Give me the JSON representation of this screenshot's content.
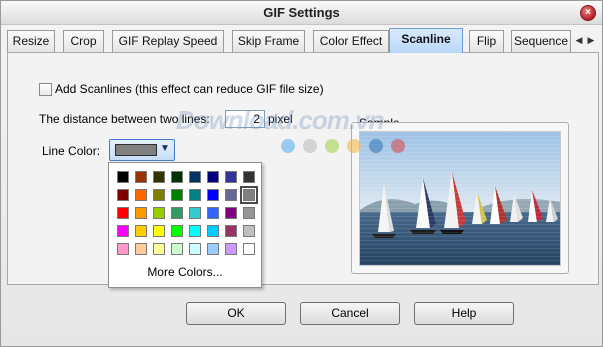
{
  "window": {
    "title": "GIF Settings"
  },
  "tabs": [
    {
      "label": "Resize"
    },
    {
      "label": "Crop"
    },
    {
      "label": "GIF Replay Speed"
    },
    {
      "label": "Skip Frame"
    },
    {
      "label": "Color Effect"
    },
    {
      "label": "Scanline",
      "active": true
    },
    {
      "label": "Flip"
    },
    {
      "label": "Sequence"
    }
  ],
  "tab_scroll": {
    "left": "◀",
    "right": "▶"
  },
  "scanline": {
    "add_checkbox_label": "Add Scanlines (this effect can reduce GIF file size)",
    "add_checked": false,
    "distance_label": "The distance between two lines:",
    "distance_value": "2",
    "distance_unit": "pixel",
    "line_color_label": "Line Color:",
    "line_color_value": "#808080",
    "sample_label": "Sample"
  },
  "color_picker": {
    "colors": [
      [
        "#000000",
        "#993300",
        "#333300",
        "#003300",
        "#003366",
        "#000080",
        "#333399",
        "#333333"
      ],
      [
        "#800000",
        "#ff6600",
        "#808000",
        "#008000",
        "#008080",
        "#0000ff",
        "#666699",
        "#808080"
      ],
      [
        "#ff0000",
        "#ff9900",
        "#99cc00",
        "#339966",
        "#33cccc",
        "#3366ff",
        "#800080",
        "#969696"
      ],
      [
        "#ff00ff",
        "#ffcc00",
        "#ffff00",
        "#00ff00",
        "#00ffff",
        "#00ccff",
        "#993366",
        "#c0c0c0"
      ],
      [
        "#ff99cc",
        "#ffcc99",
        "#ffff99",
        "#ccffcc",
        "#ccffff",
        "#99ccff",
        "#cc99ff",
        "#ffffff"
      ]
    ],
    "selected": "#808080",
    "more_colors_label": "More Colors..."
  },
  "buttons": {
    "ok": "OK",
    "cancel": "Cancel",
    "help": "Help"
  },
  "watermark": {
    "text": "Download.com.vn"
  },
  "icons": {
    "close": "close-icon",
    "dropdown": "chevron-down-icon",
    "tab_left": "arrow-left-icon",
    "tab_right": "arrow-right-icon"
  }
}
